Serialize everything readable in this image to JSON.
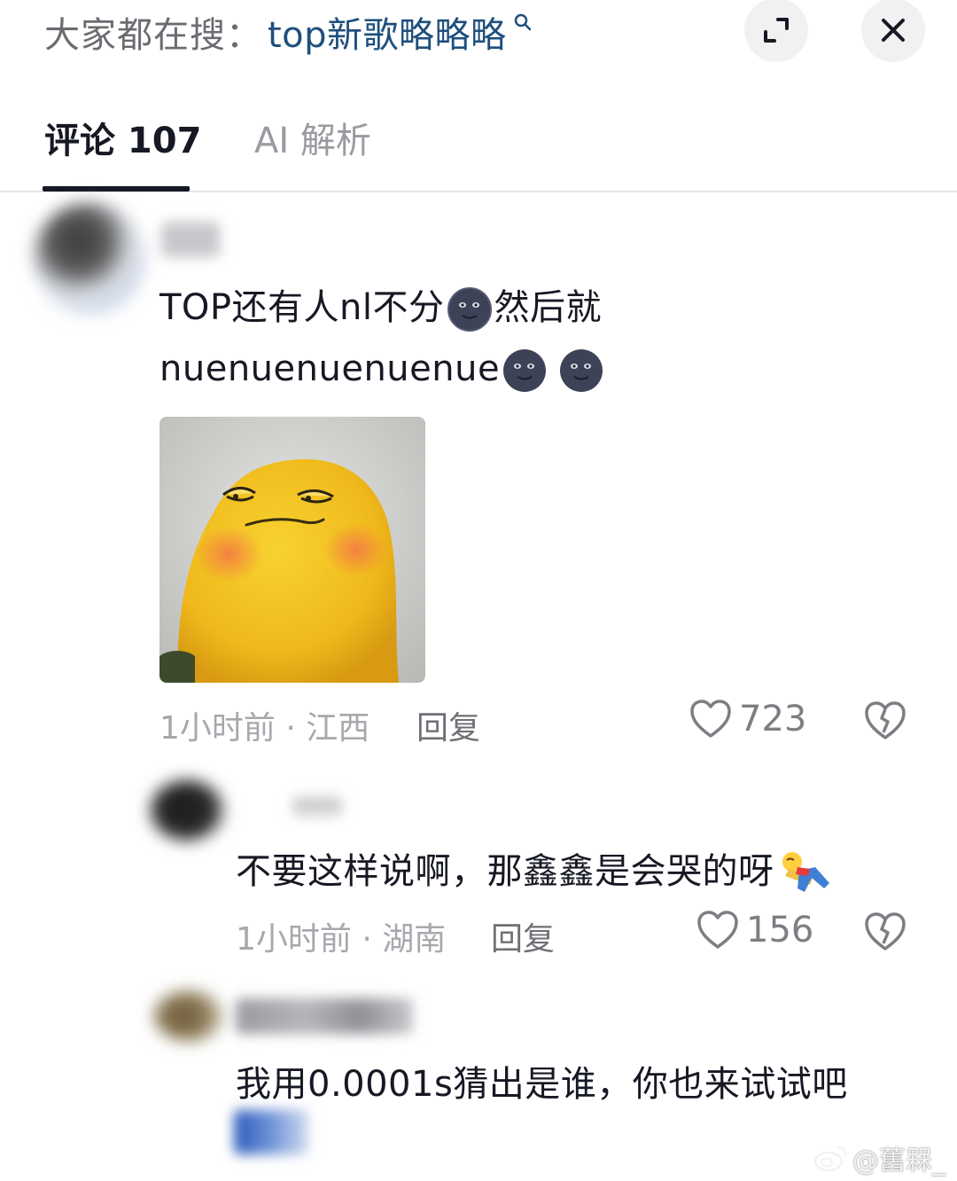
{
  "search": {
    "prefix": "大家都在搜：",
    "term": "top新歌略略略"
  },
  "tabs": [
    {
      "label": "评论 107",
      "active": true
    },
    {
      "label": "AI 解析",
      "active": false
    }
  ],
  "comments": [
    {
      "text_line1": "TOP还有人nl不分",
      "text_line1_suffix": "然后就",
      "text_line2": "nuenuenuenuenue",
      "time_location": "1小时前 · 江西",
      "reply_label": "回复",
      "likes": "723",
      "has_sticker": true
    },
    {
      "text": "不要这样说啊，那鑫鑫是会哭的呀",
      "time_location": "1小时前 · 湖南",
      "reply_label": "回复",
      "likes": "156"
    },
    {
      "text": "我用0.0001s猜出是谁，你也来试试吧"
    }
  ],
  "watermark": "@舊槑_",
  "colors": {
    "search_term": "#1f4f7d",
    "text_primary": "#161823",
    "text_muted": "#a7a7ad"
  },
  "icons": [
    "search-mini-icon",
    "expand-icon",
    "close-icon",
    "heart-icon",
    "broken-heart-icon",
    "moon-face-emoji",
    "weibo-icon"
  ]
}
